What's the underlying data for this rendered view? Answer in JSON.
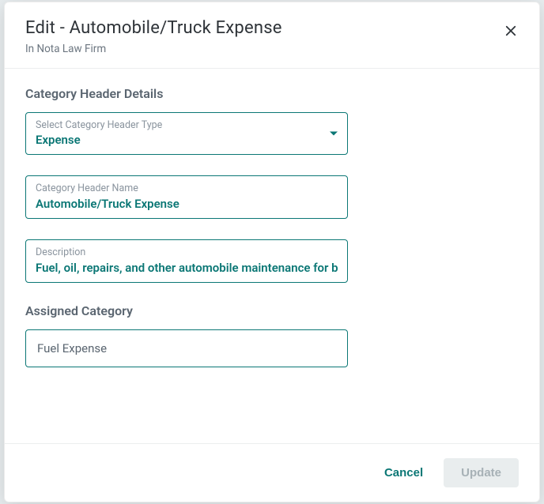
{
  "header": {
    "title": "Edit - Automobile/Truck Expense",
    "subtitle": "In Nota Law Firm"
  },
  "sections": {
    "header_details": {
      "title": "Category Header Details",
      "type_label": "Select Category Header Type",
      "type_value": "Expense",
      "name_label": "Category Header Name",
      "name_value": "Automobile/Truck Expense",
      "description_label": "Description",
      "description_value": "Fuel, oil, repairs, and other automobile maintenance for b"
    },
    "assigned": {
      "title": "Assigned Category",
      "value": "Fuel Expense"
    }
  },
  "footer": {
    "cancel": "Cancel",
    "update": "Update"
  }
}
